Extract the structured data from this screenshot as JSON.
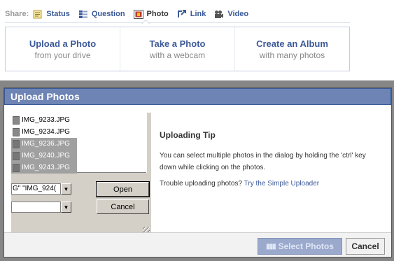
{
  "share": {
    "label": "Share:",
    "items": [
      {
        "label": "Status",
        "icon": "status-icon"
      },
      {
        "label": "Question",
        "icon": "question-icon"
      },
      {
        "label": "Photo",
        "icon": "photo-icon"
      },
      {
        "label": "Link",
        "icon": "link-icon"
      },
      {
        "label": "Video",
        "icon": "video-icon"
      }
    ]
  },
  "options": [
    {
      "title": "Upload a Photo",
      "subtitle": "from your drive"
    },
    {
      "title": "Take a Photo",
      "subtitle": "with a webcam"
    },
    {
      "title": "Create an Album",
      "subtitle": "with many photos"
    }
  ],
  "dialog": {
    "title": "Upload Photos",
    "applet": {
      "files": [
        {
          "name": "IMG_9233.JPG",
          "selected": false
        },
        {
          "name": "IMG_9234.JPG",
          "selected": false
        },
        {
          "name": "IMG_9236.JPG",
          "selected": true
        },
        {
          "name": "IMG_9240.JPG",
          "selected": true
        },
        {
          "name": "IMG_9243.JPG",
          "selected": true
        }
      ],
      "filename_value": "G\" \"IMG_924(",
      "open_label": "Open",
      "cancel_label": "Cancel"
    },
    "tip": {
      "title": "Uploading Tip",
      "text": "You can select multiple photos in the dialog by holding the 'ctrl' key down while clicking on the photos.",
      "trouble_text": "Trouble uploading photos?",
      "link_text": "Try the Simple Uploader"
    },
    "footer": {
      "select_label": "Select Photos",
      "cancel_label": "Cancel"
    }
  },
  "colors": {
    "brand_blue": "#3b5998",
    "header_blue": "#6d84b4"
  }
}
